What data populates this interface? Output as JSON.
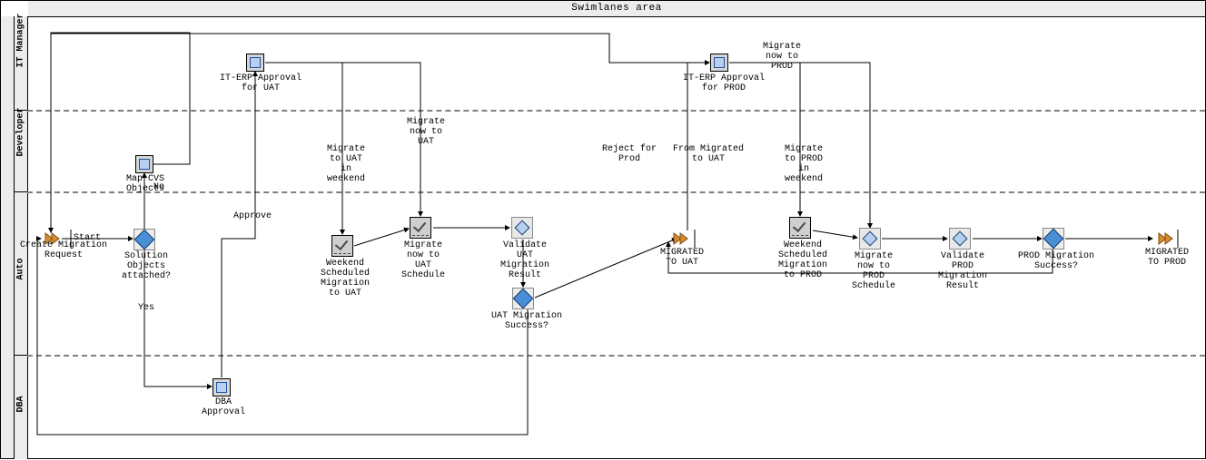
{
  "title": "Swimlanes area",
  "lanes": {
    "l1": "IT Manager",
    "l2": "Developer",
    "l3": "Auto",
    "l4": "DBA"
  },
  "nodes": {
    "start_label": "Start",
    "create_req": "Create Migration\nRequest",
    "map_cvs": "Map CVS\nObjects",
    "sol_obj": "Solution\nObjects\nattached?",
    "no": "No",
    "yes": "Yes",
    "dba_approval": "DBA\nApproval",
    "approve": "Approve",
    "iterp_uat": "IT-ERP Approval\nfor UAT",
    "mig_uat_weekend": "Migrate\nto UAT\nin\nweekend",
    "mig_now_uat": "Migrate\nnow to\nUAT",
    "wk_sched_uat": "Weekend\nScheduled\nMigration\nto UAT",
    "mig_now_uat_sched": "Migrate\nnow to\nUAT\nSchedule",
    "validate_uat": "Validate\nUAT\nMigration\nResult",
    "uat_success": "UAT Migration\nSuccess?",
    "reject_prod": "Reject for\nProd",
    "from_mig_uat": "From Migrated\nto UAT",
    "migrated_uat": "MIGRATED\nTO UAT",
    "iterp_prod": "IT-ERP Approval\nfor PROD",
    "mig_now_prod_top": "Migrate\nnow to\nPROD",
    "mig_prod_weekend": "Migrate\nto PROD\nin\nweekend",
    "wk_sched_prod": "Weekend\nScheduled\nMigration\nto PROD",
    "mig_now_prod_sched": "Migrate\nnow to\nPROD\nSchedule",
    "validate_prod": "Validate\nPROD\nMigration\nResult",
    "prod_success": "PROD Migration\nSuccess?",
    "migrated_prod": "MIGRATED\nTO PROD"
  }
}
